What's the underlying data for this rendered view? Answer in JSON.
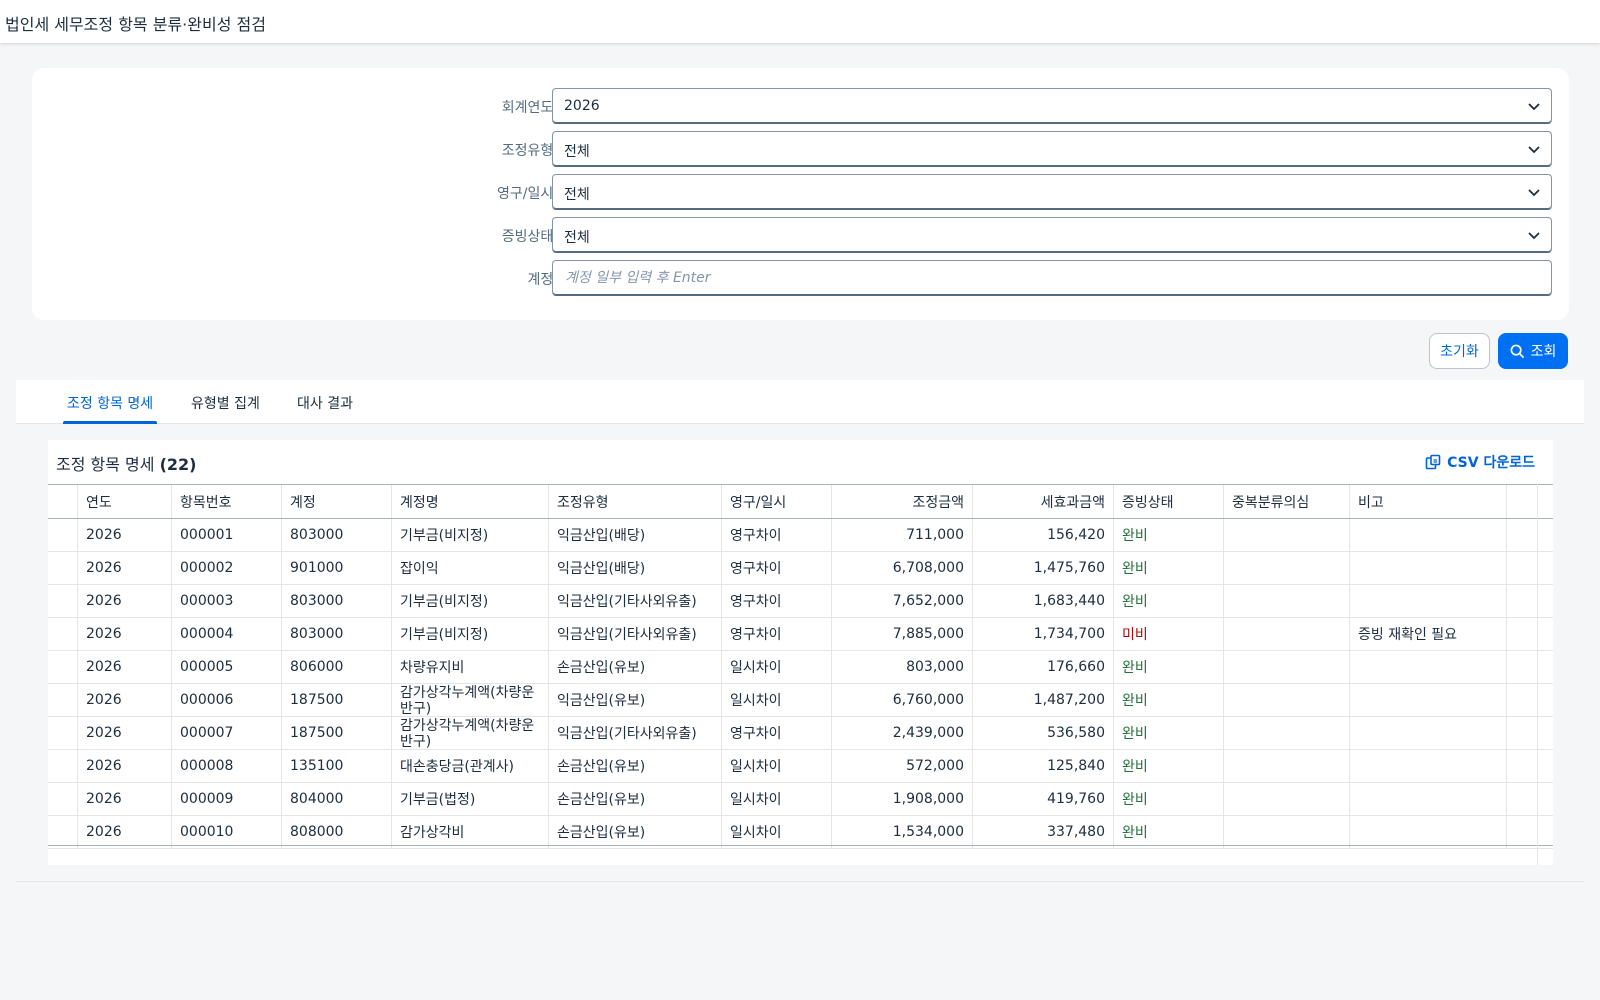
{
  "app": {
    "title": "법인세 세무조정 항목 분류·완비성 점검"
  },
  "filters": [
    {
      "key": "year",
      "label": "회계연도:",
      "value": "2026",
      "type": "select"
    },
    {
      "key": "adj_type",
      "label": "조정유형:",
      "value": "전체",
      "type": "select"
    },
    {
      "key": "perm_temp",
      "label": "영구/일시:",
      "value": "전체",
      "type": "select"
    },
    {
      "key": "evidence",
      "label": "증빙상태:",
      "value": "전체",
      "type": "select"
    },
    {
      "key": "account",
      "label": "계정:",
      "placeholder": "계정 일부 입력 후 Enter",
      "type": "input"
    }
  ],
  "actions": {
    "reset_label": "초기화",
    "search_label": "조회"
  },
  "tabs": [
    {
      "label": "조정 항목 명세",
      "active": true
    },
    {
      "label": "유형별 집계",
      "active": false
    },
    {
      "label": "대사 결과",
      "active": false
    }
  ],
  "table": {
    "title": "조정 항목 명세",
    "count": "(22)",
    "csv_label": "CSV 다운로드",
    "columns": [
      "연도",
      "항목번호",
      "계정",
      "계정명",
      "조정유형",
      "영구/일시",
      "조정금액",
      "세효과금액",
      "증빙상태",
      "중복분류의심",
      "비고"
    ],
    "rows": [
      [
        "2026",
        "000001",
        "803000",
        "기부금(비지정)",
        "익금산입(배당)",
        "영구차이",
        "711,000",
        "156,420",
        "완비",
        "",
        ""
      ],
      [
        "2026",
        "000002",
        "901000",
        "잡이익",
        "익금산입(배당)",
        "영구차이",
        "6,708,000",
        "1,475,760",
        "완비",
        "",
        ""
      ],
      [
        "2026",
        "000003",
        "803000",
        "기부금(비지정)",
        "익금산입(기타사외유출)",
        "영구차이",
        "7,652,000",
        "1,683,440",
        "완비",
        "",
        ""
      ],
      [
        "2026",
        "000004",
        "803000",
        "기부금(비지정)",
        "익금산입(기타사외유출)",
        "영구차이",
        "7,885,000",
        "1,734,700",
        "미비",
        "",
        "증빙 재확인 필요"
      ],
      [
        "2026",
        "000005",
        "806000",
        "차량유지비",
        "손금산입(유보)",
        "일시차이",
        "803,000",
        "176,660",
        "완비",
        "",
        ""
      ],
      [
        "2026",
        "000006",
        "187500",
        "감가상각누계액(차량운반구)",
        "익금산입(유보)",
        "일시차이",
        "6,760,000",
        "1,487,200",
        "완비",
        "",
        ""
      ],
      [
        "2026",
        "000007",
        "187500",
        "감가상각누계액(차량운반구)",
        "익금산입(기타사외유출)",
        "영구차이",
        "2,439,000",
        "536,580",
        "완비",
        "",
        ""
      ],
      [
        "2026",
        "000008",
        "135100",
        "대손충당금(관계사)",
        "손금산입(유보)",
        "일시차이",
        "572,000",
        "125,840",
        "완비",
        "",
        ""
      ],
      [
        "2026",
        "000009",
        "804000",
        "기부금(법정)",
        "손금산입(유보)",
        "일시차이",
        "1,908,000",
        "419,760",
        "완비",
        "",
        ""
      ],
      [
        "2026",
        "000010",
        "808000",
        "감가상각비",
        "손금산입(유보)",
        "일시차이",
        "1,534,000",
        "337,480",
        "완비",
        "",
        ""
      ]
    ]
  },
  "colors": {
    "accent": "#0070f2",
    "ok": "#256f3a",
    "bad": "#aa0808"
  },
  "icons": {
    "chevron": "chevron-down-icon",
    "search": "search-icon",
    "csv": "csv-download-icon"
  }
}
